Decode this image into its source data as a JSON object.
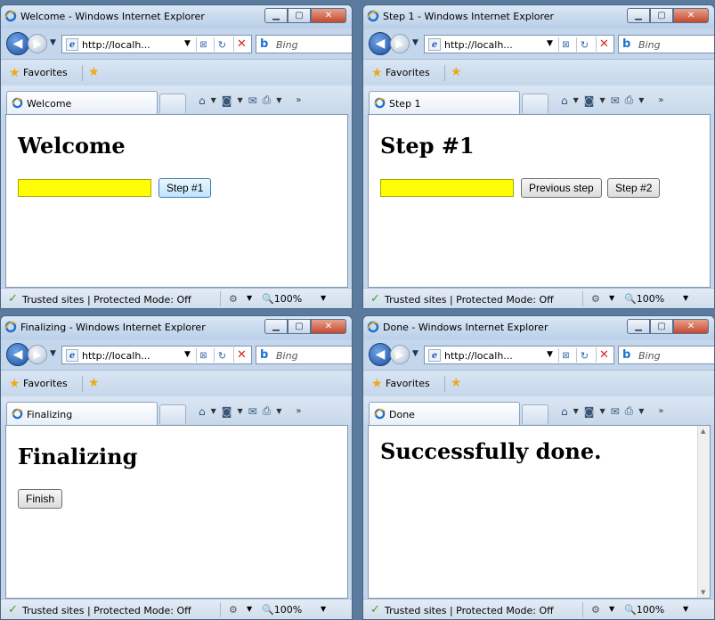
{
  "windows": [
    {
      "title": "Welcome - Windows Internet Explorer",
      "address": "http://localh...",
      "search_placeholder": "Bing",
      "favorites_label": "Favorites",
      "tab_label": "Welcome",
      "heading": "Welcome",
      "has_field": true,
      "buttons": [
        "Step #1"
      ],
      "status": "Trusted sites | Protected Mode: Off",
      "zoom": "100%"
    },
    {
      "title": "Step 1 - Windows Internet Explorer",
      "address": "http://localh...",
      "search_placeholder": "Bing",
      "favorites_label": "Favorites",
      "tab_label": "Step 1",
      "heading": "Step #1",
      "has_field": true,
      "buttons": [
        "Previous step",
        "Step #2"
      ],
      "status": "Trusted sites | Protected Mode: Off",
      "zoom": "100%"
    },
    {
      "title": "Finalizing - Windows Internet Explorer",
      "address": "http://localh...",
      "search_placeholder": "Bing",
      "favorites_label": "Favorites",
      "tab_label": "Finalizing",
      "heading": "Finalizing",
      "has_field": false,
      "buttons": [
        "Finish"
      ],
      "status": "Trusted sites | Protected Mode: Off",
      "zoom": "100%"
    },
    {
      "title": "Done - Windows Internet Explorer",
      "address": "http://localh...",
      "search_placeholder": "Bing",
      "favorites_label": "Favorites",
      "tab_label": "Done",
      "heading": "Successfully done.",
      "has_field": false,
      "buttons": [],
      "status": "Trusted sites | Protected Mode: Off",
      "zoom": "100%"
    }
  ],
  "colors": {
    "field_highlight": "#ffff00",
    "title_gradient_top": "#dbe7f5",
    "close_button": "#c44a2e"
  },
  "icons": {
    "browser": "ie-icon",
    "back": "back-arrow-icon",
    "forward": "forward-arrow-icon",
    "refresh": "refresh-icon",
    "stop": "stop-icon",
    "favorites": "star-icon",
    "status_ok": "checkmark-icon",
    "zoom": "magnifier-icon"
  }
}
